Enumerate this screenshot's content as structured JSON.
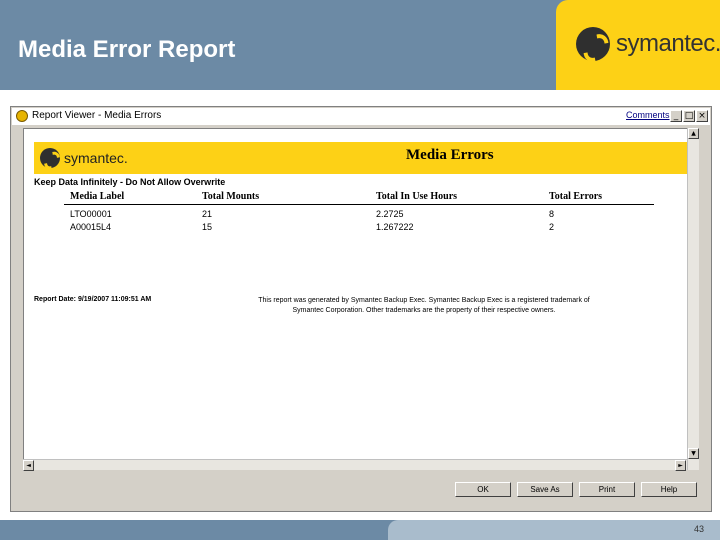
{
  "slide": {
    "title": "Media Error Report",
    "logo_text": "symantec.",
    "page_number": "43",
    "colors": {
      "header_bg": "#6c8aa5",
      "logo_bg": "#fdd116"
    }
  },
  "window": {
    "title": "Report Viewer - Media Errors",
    "comments_link": "Comments",
    "minimize": "_",
    "maximize": "□",
    "close": "×"
  },
  "report": {
    "banner_logo": "symantec.",
    "title": "Media Errors",
    "section": "Keep Data Infinitely - Do Not Allow Overwrite",
    "columns": [
      "Media Label",
      "Total Mounts",
      "Total In Use Hours",
      "Total Errors"
    ],
    "rows": [
      [
        "LTO00001",
        "21",
        "2.2725",
        "8"
      ],
      [
        "A00015L4",
        "15",
        "1.267222",
        "2"
      ]
    ],
    "report_date": "Report Date: 9/19/2007 11:09:51 AM",
    "footer_note_line1": "This report was generated by Symantec Backup Exec. Symantec Backup Exec is a registered trademark of",
    "footer_note_line2": "Symantec Corporation. Other trademarks are the property of their respective owners."
  },
  "buttons": {
    "ok": "OK",
    "save_as": "Save As",
    "print": "Print",
    "help": "Help"
  },
  "scrollbar": {
    "up": "▲",
    "down": "▼",
    "left": "◄",
    "right": "►"
  }
}
